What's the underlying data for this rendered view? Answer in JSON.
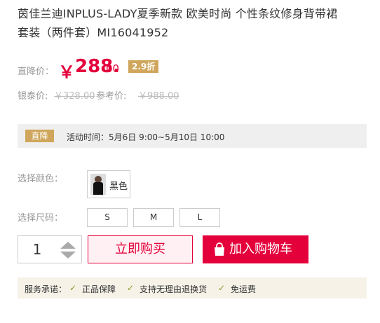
{
  "product": {
    "title_line1": "茵佳兰迪INPLUS-LADY夏季新款 欧美时尚 个性条纹修身背带裙",
    "title_line2": "套装（两件套）MI16041952"
  },
  "price": {
    "label": "直降价：",
    "currency": "￥",
    "integer": "288.",
    "decimal": "00",
    "discount": "2.9折",
    "color": "#e4003b"
  },
  "reference": {
    "yintai_label": "银泰价:",
    "yintai_price": "￥328.00",
    "ref_label": "参考价:",
    "ref_price": "￥988.00"
  },
  "promotion": {
    "tag": "直降",
    "text": "活动时间：5月6日 9:00~5月10日 10:00",
    "tag_color": "#cfa65b"
  },
  "options": {
    "color_label": "选择颜色：",
    "color_value": "黑色",
    "size_label": "选择尺码：",
    "sizes": [
      "S",
      "M",
      "L"
    ]
  },
  "purchase": {
    "quantity": "1",
    "buy_now": "立即购买",
    "add_to_cart": "加入购物车"
  },
  "service": {
    "label": "服务承诺：",
    "items": [
      "正品保障",
      "支持无理由退换货",
      "免运费"
    ],
    "check_icon": "check-icon"
  }
}
